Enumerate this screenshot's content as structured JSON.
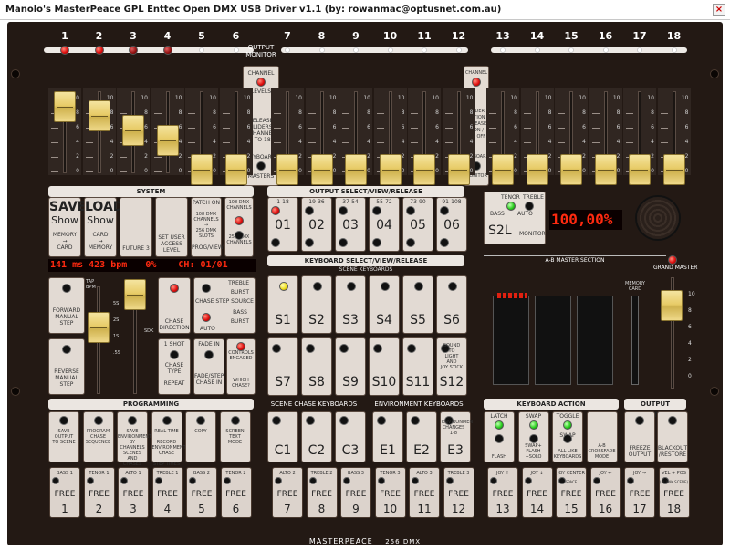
{
  "window": {
    "title": "Manolo's MasterPeace GPL Enttec Open DMX USB Driver v1.1 (by: rowanmac@optusnet.com.au)",
    "close": "×"
  },
  "channels": [
    "1",
    "2",
    "3",
    "4",
    "5",
    "6",
    "7",
    "8",
    "9",
    "10",
    "11",
    "12",
    "13",
    "14",
    "15",
    "16",
    "17",
    "18"
  ],
  "fader_scale": [
    "10",
    "8",
    "6",
    "4",
    "2",
    "0"
  ],
  "output_monitor": "OUTPUT\nMONITOR",
  "left_column": {
    "top": "CHANNEL",
    "mid": "LEVELS",
    "desc": "RELEASE SLIDERS\n(CHANNEL\n1 TO 18)",
    "kb": "KEYBOARD",
    "bottom": "MASTERS"
  },
  "right_column": {
    "top": "CHANNEL",
    "mid": "SLIDER ACTION",
    "desc": "RELEASE\n1 ON /\nALL OFF",
    "kb": "KEYBOARD",
    "bottom": "MONITOR"
  },
  "system": {
    "header": "SYSTEM",
    "save": {
      "title": "SAVE",
      "sub": "Show",
      "foot": "MEMORY\n→\nCARD"
    },
    "load": {
      "title": "LOAD",
      "sub": "Show",
      "foot": "CARD\n→\nMEMORY"
    },
    "future": "FUTURE 3",
    "access": "SET USER\nACCESS\nLEVEL",
    "patch": {
      "top": "PATCH ON",
      "mid": "108 DMX\nCHANNELS\n→\n256 DMX\nSLOTS",
      "bot": "PROG/VIEW"
    },
    "dmx": {
      "top": "108 DMX\nCHANNELS",
      "bot": "256 DMX\nCHANNELS"
    }
  },
  "status": {
    "time": "141 ms 423 bpm",
    "percent": "0%",
    "channel": "CH: 01/01"
  },
  "output_select": {
    "header": "OUTPUT SELECT/VIEW/RELEASE",
    "buttons": [
      {
        "range": "1-18",
        "label": "01"
      },
      {
        "range": "19-36",
        "label": "02"
      },
      {
        "range": "37-54",
        "label": "03"
      },
      {
        "range": "55-72",
        "label": "04"
      },
      {
        "range": "73-90",
        "label": "05"
      },
      {
        "range": "91-108",
        "label": "06"
      }
    ]
  },
  "keyboard_select": {
    "header": "KEYBOARD SELECT/VIEW/RELEASE",
    "sub": "SCENE KEYBOARDS",
    "row1": [
      "S1",
      "S2",
      "S3",
      "S4",
      "S5",
      "S6"
    ],
    "row2": [
      "S7",
      "S8",
      "S9",
      "S10",
      "S11",
      "S12"
    ],
    "sound": "SOUND\nTO\nLIGHT\nAND\nJOY STICK"
  },
  "ab_master": {
    "header": "A-B MASTER SECTION",
    "tenor": "TENOR",
    "treble": "TREBLE",
    "bass": "BASS",
    "auto": "AUTO",
    "s2l": "S2L",
    "monitor": "MONITOR",
    "level": "100,00%"
  },
  "memory_card": "MEMORY\nCARD",
  "grand_master": "GRAND MASTER",
  "chase": {
    "fwd": "FORWARD\nMANUAL\nSTEP",
    "rev": "REVERSE\nMANUAL\nSTEP",
    "tap": "TAP\nBPM",
    "scale_a": [
      "5S",
      "2S",
      "1S",
      ".5S"
    ],
    "scale_b": [
      "1",
      "4",
      "16",
      "1S"
    ],
    "sdk": "SDK",
    "direction": "CHASE\nDIRECTION",
    "step_source": "CHASE STEP SOURCE",
    "treble": "TREBLE",
    "burst": "BURST",
    "bass": "BASS",
    "auto": "AUTO",
    "oneshot": "1 SHOT",
    "type": "CHASE\nTYPE",
    "repeat": "REPEAT",
    "fadein": "FADE IN",
    "fadestep": "FADE/STEP\nCHASE IN",
    "controls": "CONTROLS\nENGAGED",
    "which": "WHICH\nCHASE?"
  },
  "programming": {
    "header": "PROGRAMMING",
    "buttons": [
      "SAVE\nOUTPUT\nTO SCENE",
      "PROGRAM\nCHASE\nSEQUENCE",
      "SAVE\nENVIRONMENT\nBY CHANNELS\nSCENES AND\nCHASES",
      "REAL TIME\n\nRECORD\nENVIRONMENT\nCHASE\n\nSTEP TIMES",
      "COPY",
      "SCREEN\nTEXT\nMODE"
    ]
  },
  "scene_chase": {
    "header": "SCENE CHASE KEYBOARDS",
    "labels": [
      "C1",
      "C2",
      "C3"
    ]
  },
  "environment": {
    "header": "ENVIRONMENT KEYBOARDS",
    "labels": [
      "E1",
      "E2",
      "E3"
    ],
    "extra": "ENVIRONMENT\nCHANGES 1-8"
  },
  "keyboard_action": {
    "header": "KEYBOARD ACTION",
    "buttons": [
      {
        "top": "LATCH",
        "bot": "FLASH"
      },
      {
        "top": "SWAP",
        "bot": "SWAP+\nFLASH\n+SOLO"
      },
      {
        "top": "TOGGLE",
        "mid": "SWAP",
        "bot": "ALL LIKE\nKEYBOARDS"
      },
      {
        "top": "",
        "bot": "A-B\nCROSSFADE\nMODE"
      }
    ]
  },
  "output_control": {
    "header": "OUTPUT CONTROL",
    "freeze": "FREEZE\nOUTPUT",
    "blackout": "BLACKOUT\n/RESTORE"
  },
  "free_buttons": [
    {
      "lab": "BASS 1",
      "sub": "",
      "num": "1"
    },
    {
      "lab": "TENOR 1",
      "sub": "",
      "num": "2"
    },
    {
      "lab": "ALTO 1",
      "sub": "",
      "num": "3"
    },
    {
      "lab": "TREBLE 1",
      "sub": "",
      "num": "4"
    },
    {
      "lab": "BASS 2",
      "sub": "",
      "num": "5"
    },
    {
      "lab": "TENOR 2",
      "sub": "",
      "num": "6"
    },
    {
      "lab": "ALTO 2",
      "sub": "",
      "num": "7"
    },
    {
      "lab": "TREBLE 2",
      "sub": "",
      "num": "8"
    },
    {
      "lab": "BASS 3",
      "sub": "",
      "num": "9"
    },
    {
      "lab": "TENOR 3",
      "sub": "",
      "num": "10"
    },
    {
      "lab": "ALTO 3",
      "sub": "",
      "num": "11"
    },
    {
      "lab": "TREBLE 3",
      "sub": "",
      "num": "12"
    },
    {
      "lab": "JOY ↑",
      "sub": "",
      "num": "13"
    },
    {
      "lab": "JOY ↓",
      "sub": "",
      "num": "14"
    },
    {
      "lab": "JOY CENTER",
      "sub": "SPACE",
      "num": "15"
    },
    {
      "lab": "JOY ←",
      "sub": "",
      "num": "16"
    },
    {
      "lab": "JOY →",
      "sub": "",
      "num": "17"
    },
    {
      "lab": "VEL + POS",
      "sub": "(BLANK SCENE)",
      "num": "18"
    }
  ],
  "free_label": "FREE",
  "footer": {
    "brand": "MASTERPEACE",
    "model": "256 DMX"
  },
  "fader_levels": [
    0.9,
    0.78,
    0.6,
    0.47,
    0.08,
    0.08,
    0.08,
    0.08,
    0.08,
    0.08,
    0.08,
    0.08,
    0.08,
    0.08,
    0.08,
    0.08,
    0.08,
    0.08
  ],
  "top_leds": [
    "red",
    "red",
    "dim",
    "dim",
    "off",
    "off",
    "off",
    "off",
    "off",
    "off",
    "off",
    "off",
    "off",
    "off",
    "off",
    "off",
    "off",
    "off"
  ]
}
